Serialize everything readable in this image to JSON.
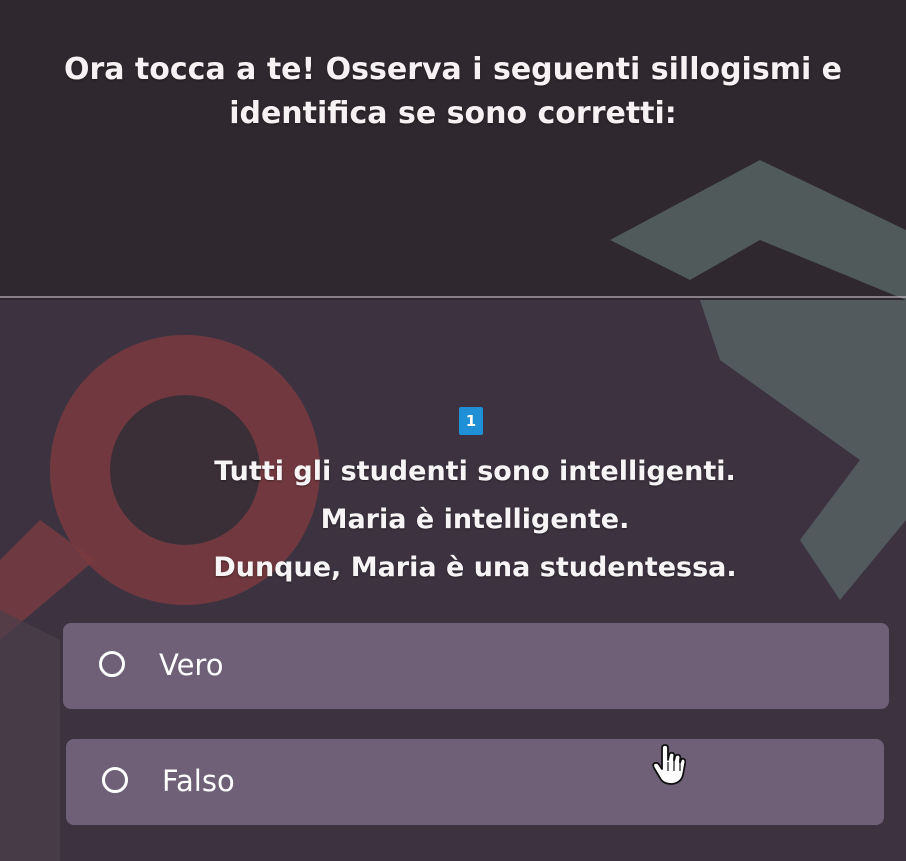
{
  "quiz": {
    "instruction": "Ora tocca a te! Osserva i seguenti sillogismi e identifica se sono corretti:",
    "question_number": "1",
    "statements": [
      "Tutti gli studenti sono intelligenti.",
      "Maria è intelligente.",
      "Dunque, Maria è una studentessa."
    ],
    "options": [
      {
        "label": "Vero",
        "selected": false
      },
      {
        "label": "Falso",
        "selected": false
      }
    ]
  },
  "colors": {
    "background": "#3a3038",
    "decor_red": "#7a3a40",
    "decor_teal": "#5c6c6c",
    "question_badge": "#1f8fd6",
    "option_card": "#766680"
  },
  "icons": {
    "cursor": "hand-pointer-icon",
    "radio": "radio-circle-icon"
  }
}
